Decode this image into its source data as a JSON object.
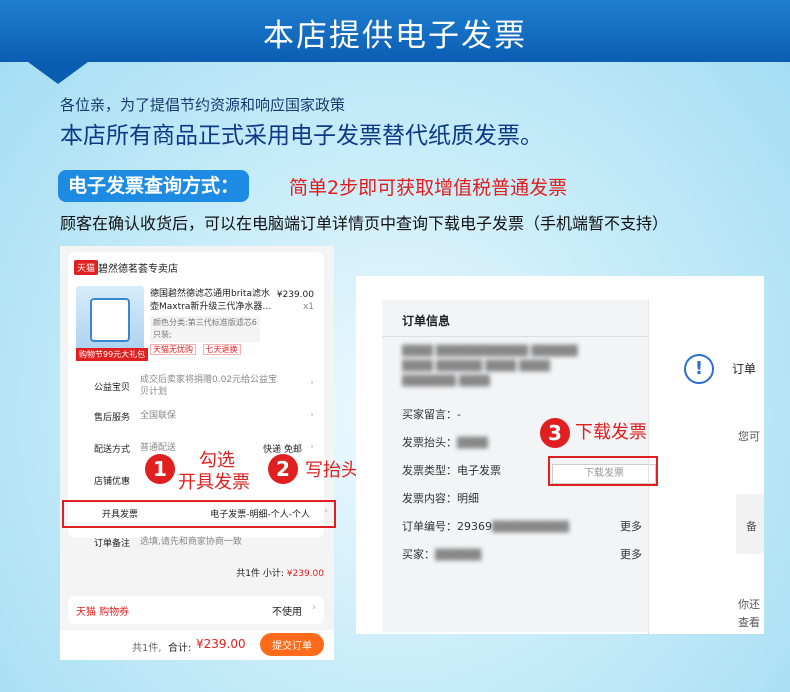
{
  "banner": {
    "title": "本店提供电子发票"
  },
  "intro": {
    "line1": "各位亲，为了提倡节约资源和响应国家政策",
    "line2": "本店所有商品正式采用电子发票替代纸质发票。"
  },
  "query": {
    "label": "电子发票查询方式：",
    "highlight": "简单2步即可获取增值税普通发票",
    "note": "顾客在确认收货后，可以在电脑端订单详情页中查询下载电子发票（手机端暂不支持）"
  },
  "phone": {
    "shop_tag": "天猫",
    "shop_name": "碧然德茗荟专卖店",
    "product_title": "德国碧然德滤芯通用brita滤水壶Maxtra新升级三代净水器…",
    "price": "¥239.00",
    "qty": "x1",
    "spec": "颜色分类:第三代标准版滤芯6只装;",
    "promo": "购物节99元大礼包",
    "tags": [
      "天猫无忧购",
      "七天退换"
    ],
    "rows": {
      "baobei": {
        "label": "公益宝贝",
        "value": "成交后卖家将捐赠0.02元给公益宝贝计划"
      },
      "service": {
        "label": "售后服务",
        "value": "全国联保"
      },
      "delivery": {
        "label": "配送方式",
        "value": "普通配送",
        "right": "快递 免邮"
      },
      "shop_discount": {
        "label": "店铺优惠"
      },
      "invoice": {
        "label": "开具发票",
        "right": "电子发票-明细-个人-个人"
      },
      "remark": {
        "label": "订单备注",
        "value": "选填,请先和商家协商一致"
      }
    },
    "subtotal_prefix": "共1件 小计:",
    "subtotal_value": "¥239.00",
    "coupon_label": "天猫 购物券",
    "coupon_value": "不使用",
    "bottom_count": "共1件,",
    "bottom_total_label": "合计:",
    "bottom_total": "¥239.00",
    "submit": "提交订单"
  },
  "steps": {
    "s1": {
      "num": "1",
      "text1": "勾选",
      "text2": "开具发票"
    },
    "s2": {
      "num": "2",
      "text": "写抬头"
    },
    "s3": {
      "num": "3",
      "text": "下载发票"
    }
  },
  "desktop": {
    "title": "订单信息",
    "rows": {
      "remark": {
        "label": "买家留言：",
        "value": "-"
      },
      "header": {
        "label": "发票抬头："
      },
      "type": {
        "label": "发票类型：",
        "value": "电子发票"
      },
      "content": {
        "label": "发票内容：",
        "value": "明细"
      },
      "order_no": {
        "label": "订单编号：",
        "value": "29369"
      },
      "buyer": {
        "label": "买家："
      }
    },
    "more1": "更多",
    "more2": "更多",
    "download_btn": "下载发票",
    "right_title": "订单",
    "right_text1": "您可",
    "right_text2": "备",
    "right_text3": "你还",
    "right_text4": "查看"
  }
}
